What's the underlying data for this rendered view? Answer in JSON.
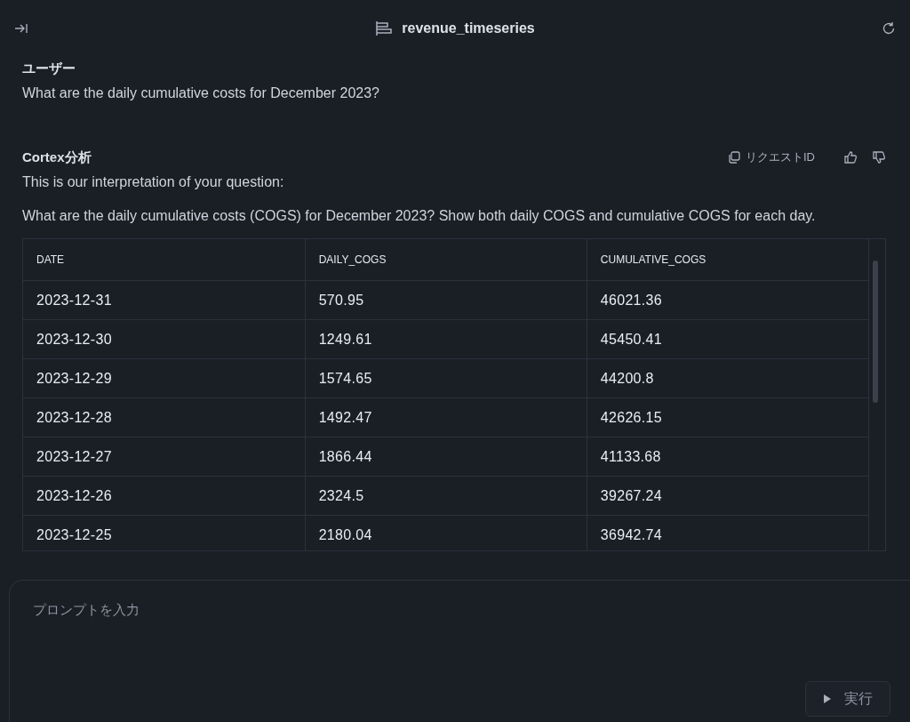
{
  "header": {
    "title": "revenue_timeseries"
  },
  "user_message": {
    "author": "ユーザー",
    "text": "What are the daily cumulative costs for December 2023?"
  },
  "response": {
    "author": "Cortex分析",
    "request_id_label": "リクエストID",
    "intro": "This is our interpretation of your question:",
    "interpretation": "What are the daily cumulative costs (COGS) for December 2023? Show both daily COGS and cumulative COGS for each day.",
    "table": {
      "columns": [
        "DATE",
        "DAILY_COGS",
        "CUMULATIVE_COGS"
      ],
      "rows": [
        [
          "2023-12-31",
          "570.95",
          "46021.36"
        ],
        [
          "2023-12-30",
          "1249.61",
          "45450.41"
        ],
        [
          "2023-12-29",
          "1574.65",
          "44200.8"
        ],
        [
          "2023-12-28",
          "1492.47",
          "42626.15"
        ],
        [
          "2023-12-27",
          "1866.44",
          "41133.68"
        ],
        [
          "2023-12-26",
          "2324.5",
          "39267.24"
        ],
        [
          "2023-12-25",
          "2180.04",
          "36942.74"
        ]
      ]
    }
  },
  "prompt": {
    "placeholder": "プロンプトを入力",
    "run_button": {
      "label": "実行",
      "disabled": true
    }
  }
}
